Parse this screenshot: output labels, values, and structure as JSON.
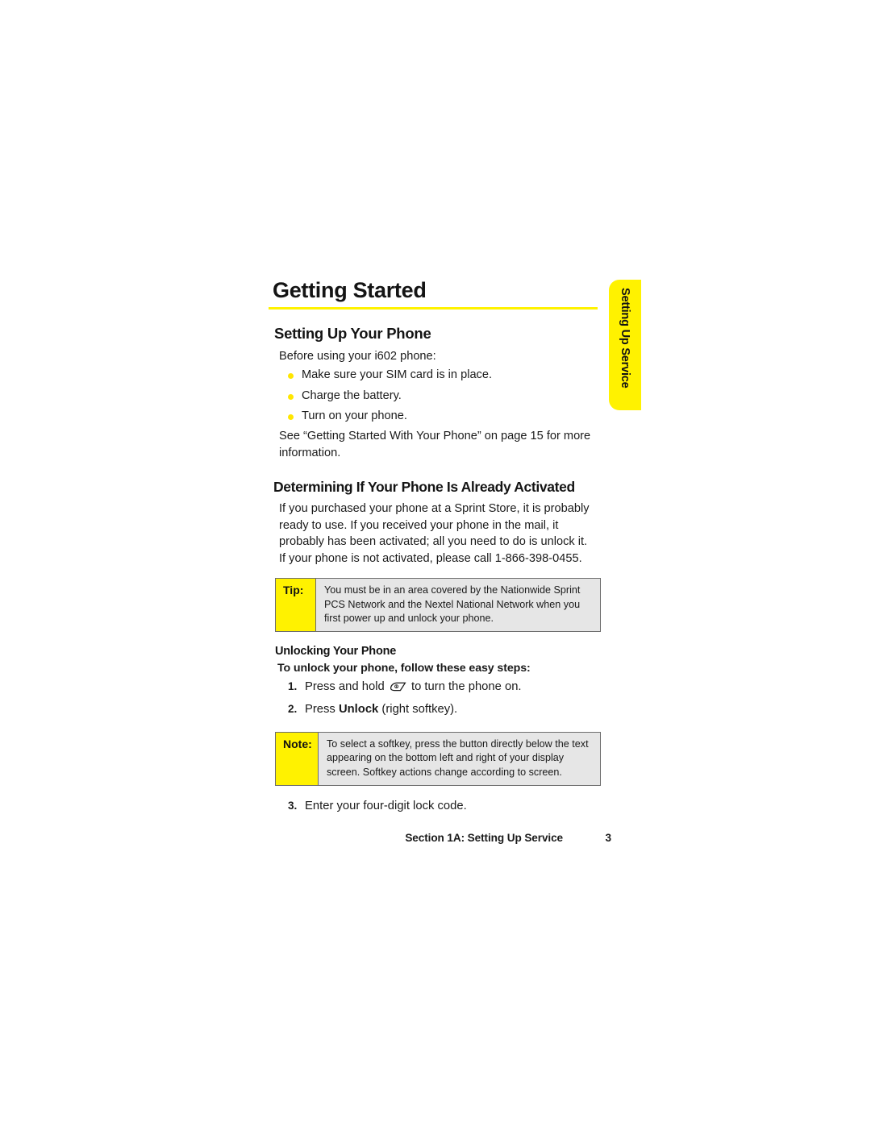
{
  "document": {
    "chapter_title": "Getting Started"
  },
  "side_tab": {
    "label": "Setting Up Service"
  },
  "sections": {
    "setting_up": {
      "heading": "Setting Up Your Phone",
      "intro": "Before using your i602 phone:",
      "bullets": [
        "Make sure your SIM card is in place.",
        "Charge the battery.",
        "Turn on your phone."
      ],
      "cross_reference": "See “Getting Started With Your Phone” on page 15 for more information."
    },
    "determining": {
      "heading": "Determining If Your Phone Is Already Activated",
      "paragraph": "If you purchased your phone at a Sprint Store, it is probably ready to use. If you received your phone in the mail, it probably has been activated; all you need to do is unlock it. If your phone is not activated, please call 1-866-398-0455."
    },
    "tip_callout": {
      "label": "Tip:",
      "text": "You must be in an area covered by the Nationwide Sprint PCS Network and the Nextel National Network when you first power up and unlock your phone."
    },
    "unlocking": {
      "heading": "Unlocking Your Phone",
      "lead_in": "To unlock your phone, follow these easy steps:",
      "steps": [
        {
          "number": "1.",
          "text_before": "Press and hold",
          "icon": "power-key-icon",
          "text_after": "to turn the phone on."
        },
        {
          "number": "2.",
          "text_before": "Press",
          "emphasis": "Unlock",
          "text_after": "(right softkey)."
        }
      ],
      "final_step": {
        "number": "3.",
        "text": "Enter your four-digit lock code."
      }
    },
    "note_callout": {
      "label": "Note:",
      "text": "To select a softkey, press the button directly below the text appearing on the bottom left and right of your display screen. Softkey actions change according to screen."
    }
  },
  "footer": {
    "section": "Section 1A: Setting Up Service",
    "page_number": "3"
  },
  "colors": {
    "accent_yellow": "#fff200",
    "bullet_yellow": "#ffe600",
    "callout_grey": "#e6e6e6",
    "callout_border": "#6d6d6d",
    "text": "#1a1a1a"
  }
}
